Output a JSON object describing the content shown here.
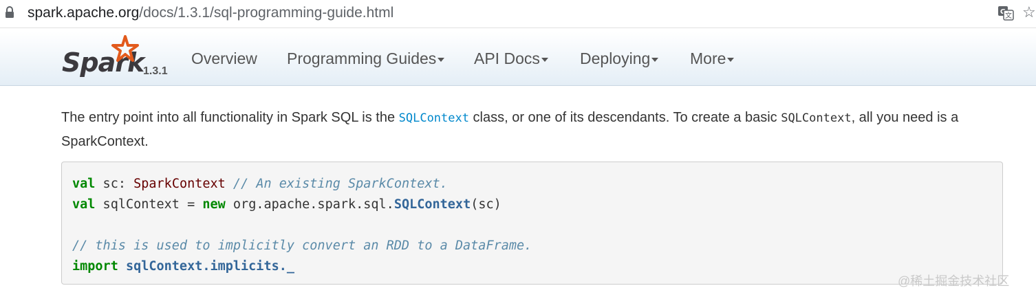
{
  "browser": {
    "url_domain": "spark.apache.org",
    "url_path": "/docs/1.3.1/sql-programming-guide.html"
  },
  "navbar": {
    "brand": "Spark",
    "version": "1.3.1",
    "items": [
      {
        "label": "Overview",
        "dropdown": false
      },
      {
        "label": "Programming Guides",
        "dropdown": true
      },
      {
        "label": "API Docs",
        "dropdown": true
      },
      {
        "label": "Deploying",
        "dropdown": true
      },
      {
        "label": "More",
        "dropdown": true
      }
    ]
  },
  "content": {
    "para_1": "The entry point into all functionality in Spark SQL is the ",
    "sqlcontext_link": "SQLContext",
    "para_2": " class, or one of its descendants. To create a basic ",
    "sqlcontext_code": "SQLContext",
    "para_3": ", all you need is a SparkContext.",
    "code": {
      "line1_kw": "val",
      "line1_name": " sc: ",
      "line1_type": "SparkContext",
      "line1_comment": " // An existing SparkContext.",
      "line2_kw": "val",
      "line2_name": " sqlContext = ",
      "line2_new": "new",
      "line2_pkg": " org.apache.spark.sql.",
      "line2_cls": "SQLContext",
      "line2_args": "(sc)",
      "line4_comment": "// this is used to implicitly convert an RDD to a DataFrame.",
      "line5_kw": "import",
      "line5_rest": " sqlContext.implicits._"
    }
  },
  "watermark": "@稀土掘金技术社区",
  "colors": {
    "link": "#0088cc",
    "keyword": "#008800",
    "type": "#660000",
    "comment": "#5a8aa8",
    "logo_orange": "#e25a1c"
  }
}
